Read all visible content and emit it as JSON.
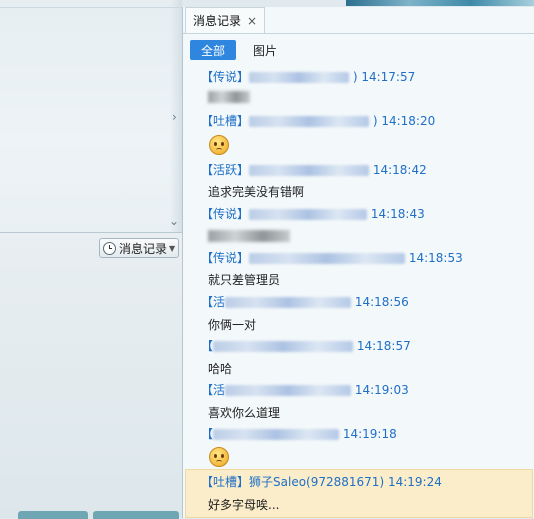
{
  "left": {
    "history_button_label": "消息记录",
    "chevron_right": "›",
    "chevron_down": "⌄"
  },
  "panel": {
    "tab_title": "消息记录",
    "tab_close": "×",
    "filters": {
      "all": "全部",
      "images": "图片"
    },
    "messages": [
      {
        "tag": "【传说】",
        "time": "14:17:57",
        "body_type": "blurred"
      },
      {
        "tag": "【吐槽】",
        "time": "14:18:20",
        "body_type": "emoji"
      },
      {
        "tag": "【活跃】",
        "time": "14:18:42",
        "body": "追求完美没有错啊"
      },
      {
        "tag": "【传说】",
        "time": "14:18:43",
        "body_type": "blurred"
      },
      {
        "tag": "【传说】",
        "time": "14:18:53",
        "body": "就只差管理员"
      },
      {
        "tag": "【活",
        "time": "14:18:56",
        "body": "你俩一对"
      },
      {
        "tag": "【",
        "time": "14:18:57",
        "body": "哈哈"
      },
      {
        "tag": "【活",
        "time": "14:19:03",
        "body": "喜欢你么道理"
      },
      {
        "tag": "【",
        "time": "14:19:18",
        "body_type": "emoji"
      },
      {
        "tag": "【吐槽】",
        "name": "狮子Saleo(972881671)",
        "time": "14:19:24",
        "body": "好多字母唉..."
      }
    ]
  },
  "colors": {
    "accent": "#2e86de",
    "tag_blue": "#1f6fc7",
    "highlight": "#fbedc9"
  }
}
